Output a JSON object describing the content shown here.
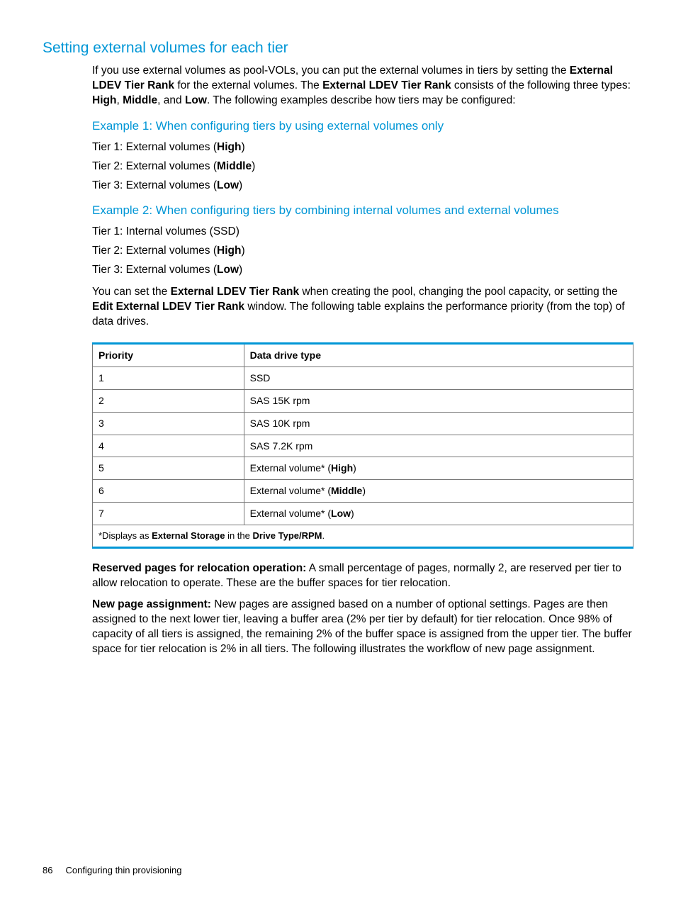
{
  "section_title": "Setting external volumes for each tier",
  "intro": {
    "part1": "If you use external volumes as pool-VOLs, you can put the external volumes in tiers by setting the ",
    "bold1": "External LDEV Tier Rank",
    "part2": " for the external volumes. The ",
    "bold2": "External LDEV Tier Rank",
    "part3": " consists of the following three types: ",
    "bold3": "High",
    "part4": ", ",
    "bold4": "Middle",
    "part5": ", and ",
    "bold5": "Low",
    "part6": ". The following examples describe how tiers may be configured:"
  },
  "example1": {
    "heading": "Example 1: When configuring tiers by using external volumes only",
    "tiers": [
      {
        "prefix": "Tier 1: External volumes (",
        "bold": "High",
        "suffix": ")"
      },
      {
        "prefix": "Tier 2: External volumes (",
        "bold": "Middle",
        "suffix": ")"
      },
      {
        "prefix": "Tier 3: External volumes (",
        "bold": "Low",
        "suffix": ")"
      }
    ]
  },
  "example2": {
    "heading": "Example 2: When configuring tiers by combining internal volumes and external volumes",
    "tiers": [
      {
        "prefix": "Tier 1: Internal volumes (SSD)",
        "bold": "",
        "suffix": ""
      },
      {
        "prefix": "Tier 2: External volumes (",
        "bold": "High",
        "suffix": ")"
      },
      {
        "prefix": "Tier 3: External volumes (",
        "bold": "Low",
        "suffix": ")"
      }
    ]
  },
  "post_example": {
    "part1": "You can set the ",
    "bold1": "External LDEV Tier Rank",
    "part2": " when creating the pool, changing the pool capacity, or setting the ",
    "bold2": "Edit External LDEV Tier Rank",
    "part3": " window. The following table explains the performance priority (from the top) of data drives."
  },
  "table": {
    "headers": [
      "Priority",
      "Data drive type"
    ],
    "rows": [
      {
        "priority": "1",
        "type_prefix": "SSD",
        "type_bold": "",
        "type_suffix": ""
      },
      {
        "priority": "2",
        "type_prefix": "SAS 15K rpm",
        "type_bold": "",
        "type_suffix": ""
      },
      {
        "priority": "3",
        "type_prefix": "SAS 10K rpm",
        "type_bold": "",
        "type_suffix": ""
      },
      {
        "priority": "4",
        "type_prefix": "SAS 7.2K rpm",
        "type_bold": "",
        "type_suffix": ""
      },
      {
        "priority": "5",
        "type_prefix": "External volume* (",
        "type_bold": "High",
        "type_suffix": ")"
      },
      {
        "priority": "6",
        "type_prefix": "External volume* (",
        "type_bold": "Middle",
        "type_suffix": ")"
      },
      {
        "priority": "7",
        "type_prefix": "External volume* (",
        "type_bold": "Low",
        "type_suffix": ")"
      }
    ],
    "footnote": {
      "part1": "*Displays as ",
      "bold1": "External Storage",
      "part2": " in the ",
      "bold2": "Drive Type/RPM",
      "part3": "."
    }
  },
  "reserved": {
    "bold": "Reserved pages for relocation operation:",
    "text": " A small percentage of pages, normally 2, are reserved per tier to allow relocation to operate. These are the buffer spaces for tier relocation."
  },
  "newpage": {
    "bold": "New page assignment:",
    "text": " New pages are assigned based on a number of optional settings. Pages are then assigned to the next lower tier, leaving a buffer area (2% per tier by default) for tier relocation. Once 98% of capacity of all tiers is assigned, the remaining 2% of the buffer space is assigned from the upper tier. The buffer space for tier relocation is 2% in all tiers. The following illustrates the workflow of new page assignment."
  },
  "footer": {
    "page_number": "86",
    "chapter": "Configuring thin provisioning"
  }
}
